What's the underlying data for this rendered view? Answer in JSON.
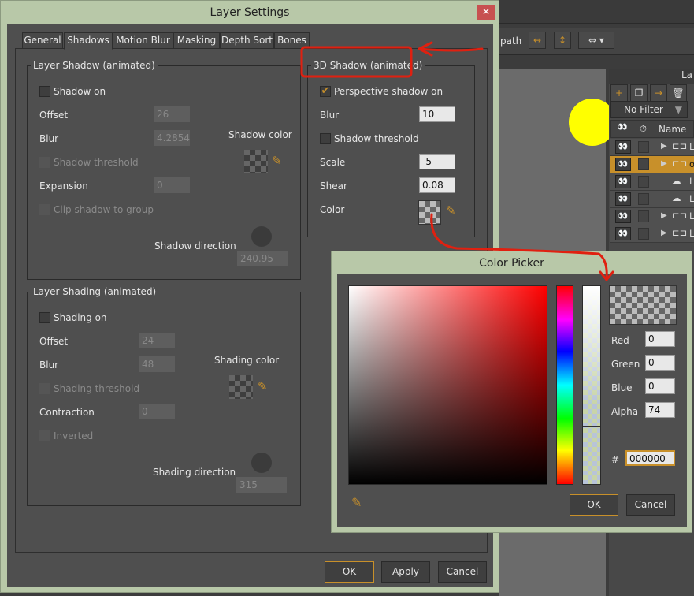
{
  "background_app": {
    "toolbar_text": "path",
    "layers_panel": {
      "title": "La",
      "filter": "No Filter",
      "columns": {
        "name": "Name"
      },
      "rows": [
        {
          "type": "bone",
          "label": "L",
          "expandable": true,
          "selected": false
        },
        {
          "type": "bone",
          "label": "o",
          "expandable": true,
          "selected": true
        },
        {
          "type": "vector",
          "label": "L",
          "expandable": false,
          "selected": false
        },
        {
          "type": "vector",
          "label": "L",
          "expandable": false,
          "selected": false
        },
        {
          "type": "bone",
          "label": "L",
          "expandable": true,
          "selected": false
        },
        {
          "type": "bone",
          "label": "L",
          "expandable": true,
          "selected": false
        }
      ]
    }
  },
  "layer_settings": {
    "title": "Layer Settings",
    "tabs": [
      "General",
      "Shadows",
      "Motion Blur",
      "Masking",
      "Depth Sort",
      "Bones"
    ],
    "active_tab": "Shadows",
    "layer_shadow": {
      "title": "Layer Shadow (animated)",
      "shadow_on": "Shadow on",
      "offset_label": "Offset",
      "offset": "26",
      "blur_label": "Blur",
      "blur": "4.2854",
      "threshold": "Shadow threshold",
      "expansion_label": "Expansion",
      "expansion": "0",
      "clip": "Clip shadow to group",
      "color_label": "Shadow color",
      "direction_label": "Shadow direction",
      "direction": "240.95"
    },
    "shadow_3d": {
      "title": "3D Shadow (animated)",
      "perspective": "Perspective shadow on",
      "perspective_checked": true,
      "blur_label": "Blur",
      "blur": "10",
      "threshold": "Shadow threshold",
      "scale_label": "Scale",
      "scale": "-5",
      "shear_label": "Shear",
      "shear": "0.08",
      "color_label": "Color"
    },
    "layer_shading": {
      "title": "Layer Shading (animated)",
      "shading_on": "Shading on",
      "offset_label": "Offset",
      "offset": "24",
      "blur_label": "Blur",
      "blur": "48",
      "threshold": "Shading threshold",
      "contraction_label": "Contraction",
      "contraction": "0",
      "inverted": "Inverted",
      "color_label": "Shading color",
      "direction_label": "Shading direction",
      "direction": "315"
    },
    "buttons": {
      "ok": "OK",
      "apply": "Apply",
      "cancel": "Cancel"
    }
  },
  "color_picker": {
    "title": "Color Picker",
    "red_label": "Red",
    "red": "0",
    "green_label": "Green",
    "green": "0",
    "blue_label": "Blue",
    "blue": "0",
    "alpha_label": "Alpha",
    "alpha": "74",
    "hex_label": "#",
    "hex": "000000",
    "ok": "OK",
    "cancel": "Cancel"
  },
  "colors": {
    "accent": "#c8902a",
    "dialog_frame": "#b8c8a8",
    "annotation": "#e02010"
  }
}
